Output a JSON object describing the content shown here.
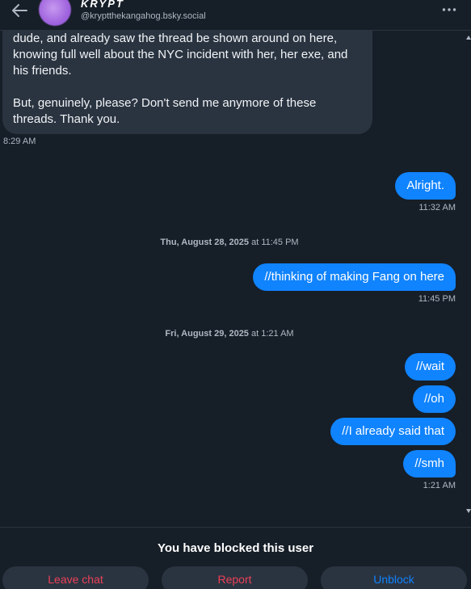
{
  "header": {
    "display_name": "KRYPT",
    "handle": "@kryptthekangahog.bsky.social",
    "back_icon": "arrow-left-icon",
    "more_icon": "ellipsis-icon"
  },
  "messages": {
    "incoming": {
      "paragraphs": [
        "dude, and already saw the thread be shown around on here, knowing full well about the NYC incident with her, her exe, and his friends.",
        "But, genuinely, please? Don't send me anymore of these threads. Thank you."
      ],
      "time": "8:29 AM"
    },
    "reply1": {
      "text": "Alright.",
      "time": "11:32 AM"
    },
    "date1": {
      "day": "Thu, August 28, 2025",
      "at": " at 11:45 PM"
    },
    "reply2": {
      "text": "//thinking of making Fang on here",
      "time": "11:45 PM"
    },
    "date2": {
      "day": "Fri, August 29, 2025",
      "at": " at 1:21 AM"
    },
    "group": {
      "items": [
        "//wait",
        "//oh",
        "//I already said that",
        "//smh"
      ],
      "time": "1:21 AM"
    }
  },
  "footer": {
    "status": "You have blocked this user",
    "buttons": {
      "leave": "Leave chat",
      "report": "Report",
      "unblock": "Unblock"
    }
  },
  "colors": {
    "background": "#161e27",
    "incoming_bubble": "#2a3441",
    "outgoing_bubble": "#1083fe",
    "danger": "#ec4058",
    "link": "#1083fe"
  }
}
